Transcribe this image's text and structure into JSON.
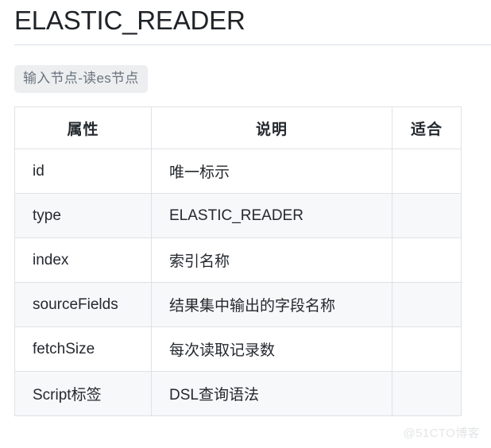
{
  "header": {
    "title": "ELASTIC_READER"
  },
  "badge": {
    "label": "输入节点-读es节点"
  },
  "table": {
    "columns": [
      {
        "key": "attribute",
        "label": "属性"
      },
      {
        "key": "description",
        "label": "说明"
      },
      {
        "key": "suitable",
        "label": "适合"
      }
    ],
    "rows": [
      {
        "attribute": "id",
        "description": "唯一标示",
        "suitable": ""
      },
      {
        "attribute": "type",
        "description": "ELASTIC_READER",
        "suitable": ""
      },
      {
        "attribute": "index",
        "description": "索引名称",
        "suitable": ""
      },
      {
        "attribute": "sourceFields",
        "description": "结果集中输出的字段名称",
        "suitable": ""
      },
      {
        "attribute": "fetchSize",
        "description": "每次读取记录数",
        "suitable": ""
      },
      {
        "attribute": "Script标签",
        "description": "DSL查询语法",
        "suitable": ""
      }
    ]
  },
  "watermark": {
    "text": "@51CTO博客"
  },
  "colors": {
    "text": "#24292e",
    "title": "#1f2328",
    "border": "#dfe2e5",
    "stripe": "#f6f8fa",
    "badge_bg": "#eceef0",
    "badge_text": "#6a737d",
    "rule": "#d8dee4",
    "watermark": "#e3e5e8"
  }
}
